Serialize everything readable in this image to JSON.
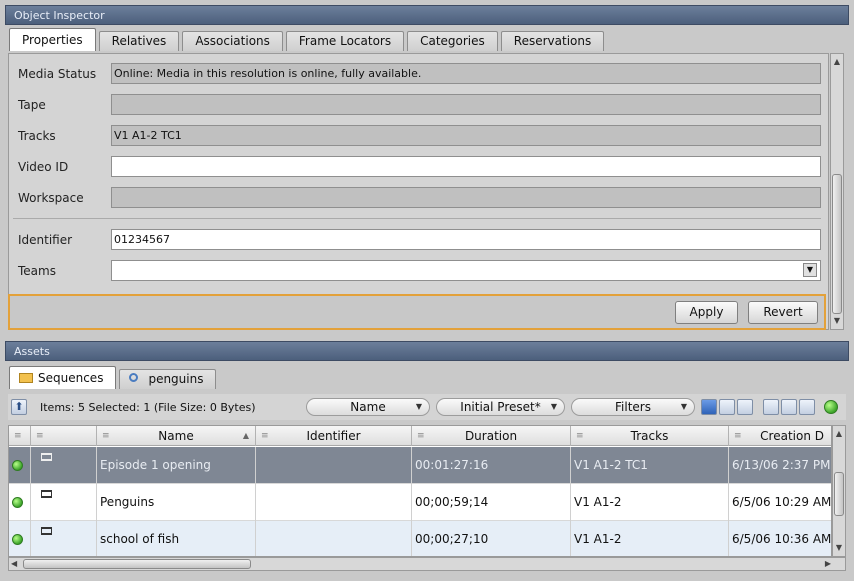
{
  "inspector": {
    "title": "Object Inspector",
    "tabs": [
      "Properties",
      "Relatives",
      "Associations",
      "Frame Locators",
      "Categories",
      "Reservations"
    ],
    "fields": {
      "media_status": {
        "label": "Media Status",
        "value": "Online: Media in this resolution is online, fully available."
      },
      "tape": {
        "label": "Tape",
        "value": ""
      },
      "tracks": {
        "label": "Tracks",
        "value": "V1 A1-2 TC1"
      },
      "video_id": {
        "label": "Video ID",
        "value": ""
      },
      "workspace": {
        "label": "Workspace",
        "value": ""
      },
      "identifier": {
        "label": "Identifier",
        "value": "01234567"
      },
      "teams": {
        "label": "Teams",
        "value": ""
      }
    },
    "apply_label": "Apply",
    "revert_label": "Revert"
  },
  "assets": {
    "title": "Assets",
    "tabs": [
      "Sequences",
      "penguins"
    ],
    "summary": "Items: 5 Selected: 1 (File Size: 0 Bytes)",
    "sort_combo": "Name",
    "preset_combo": "Initial Preset*",
    "filters_combo": "Filters",
    "columns": [
      "Name",
      "Identifier",
      "Duration",
      "Tracks",
      "Creation D"
    ],
    "rows": [
      {
        "name": "Episode 1 opening",
        "identifier": "",
        "duration": "00:01:27:16",
        "tracks": "V1 A1-2 TC1",
        "creation": "6/13/06 2:37 PM",
        "selected": true
      },
      {
        "name": "Penguins",
        "identifier": "",
        "duration": "00;00;59;14",
        "tracks": "V1 A1-2",
        "creation": "6/5/06 10:29 AM",
        "selected": false
      },
      {
        "name": "school of fish",
        "identifier": "",
        "duration": "00;00;27;10",
        "tracks": "V1 A1-2",
        "creation": "6/5/06 10:36 AM",
        "selected": false
      }
    ]
  },
  "colors": {
    "accent_border": "#e3a13a",
    "selected_row": "#7f8794",
    "header": "#55688a"
  },
  "icons": [
    "folder-icon",
    "search-icon",
    "up-arrow-icon",
    "list-view-icon",
    "status-dot-icon",
    "sequence-icon"
  ]
}
